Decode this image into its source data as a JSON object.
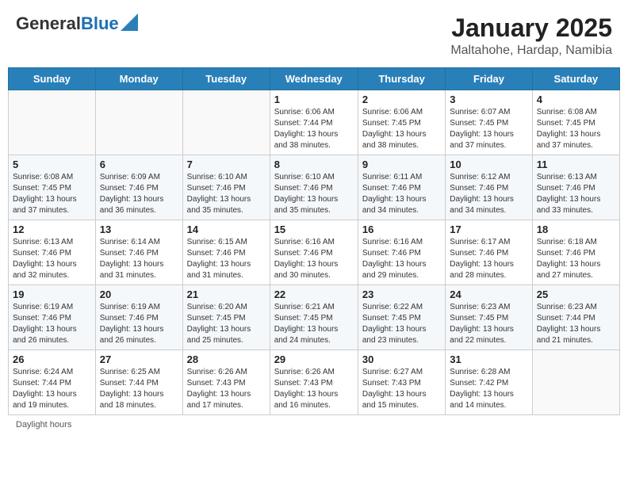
{
  "header": {
    "logo_general": "General",
    "logo_blue": "Blue",
    "month_year": "January 2025",
    "location": "Maltahohe, Hardap, Namibia"
  },
  "days_of_week": [
    "Sunday",
    "Monday",
    "Tuesday",
    "Wednesday",
    "Thursday",
    "Friday",
    "Saturday"
  ],
  "weeks": [
    [
      {
        "day": "",
        "info": ""
      },
      {
        "day": "",
        "info": ""
      },
      {
        "day": "",
        "info": ""
      },
      {
        "day": "1",
        "info": "Sunrise: 6:06 AM\nSunset: 7:44 PM\nDaylight: 13 hours\nand 38 minutes."
      },
      {
        "day": "2",
        "info": "Sunrise: 6:06 AM\nSunset: 7:45 PM\nDaylight: 13 hours\nand 38 minutes."
      },
      {
        "day": "3",
        "info": "Sunrise: 6:07 AM\nSunset: 7:45 PM\nDaylight: 13 hours\nand 37 minutes."
      },
      {
        "day": "4",
        "info": "Sunrise: 6:08 AM\nSunset: 7:45 PM\nDaylight: 13 hours\nand 37 minutes."
      }
    ],
    [
      {
        "day": "5",
        "info": "Sunrise: 6:08 AM\nSunset: 7:45 PM\nDaylight: 13 hours\nand 37 minutes."
      },
      {
        "day": "6",
        "info": "Sunrise: 6:09 AM\nSunset: 7:46 PM\nDaylight: 13 hours\nand 36 minutes."
      },
      {
        "day": "7",
        "info": "Sunrise: 6:10 AM\nSunset: 7:46 PM\nDaylight: 13 hours\nand 35 minutes."
      },
      {
        "day": "8",
        "info": "Sunrise: 6:10 AM\nSunset: 7:46 PM\nDaylight: 13 hours\nand 35 minutes."
      },
      {
        "day": "9",
        "info": "Sunrise: 6:11 AM\nSunset: 7:46 PM\nDaylight: 13 hours\nand 34 minutes."
      },
      {
        "day": "10",
        "info": "Sunrise: 6:12 AM\nSunset: 7:46 PM\nDaylight: 13 hours\nand 34 minutes."
      },
      {
        "day": "11",
        "info": "Sunrise: 6:13 AM\nSunset: 7:46 PM\nDaylight: 13 hours\nand 33 minutes."
      }
    ],
    [
      {
        "day": "12",
        "info": "Sunrise: 6:13 AM\nSunset: 7:46 PM\nDaylight: 13 hours\nand 32 minutes."
      },
      {
        "day": "13",
        "info": "Sunrise: 6:14 AM\nSunset: 7:46 PM\nDaylight: 13 hours\nand 31 minutes."
      },
      {
        "day": "14",
        "info": "Sunrise: 6:15 AM\nSunset: 7:46 PM\nDaylight: 13 hours\nand 31 minutes."
      },
      {
        "day": "15",
        "info": "Sunrise: 6:16 AM\nSunset: 7:46 PM\nDaylight: 13 hours\nand 30 minutes."
      },
      {
        "day": "16",
        "info": "Sunrise: 6:16 AM\nSunset: 7:46 PM\nDaylight: 13 hours\nand 29 minutes."
      },
      {
        "day": "17",
        "info": "Sunrise: 6:17 AM\nSunset: 7:46 PM\nDaylight: 13 hours\nand 28 minutes."
      },
      {
        "day": "18",
        "info": "Sunrise: 6:18 AM\nSunset: 7:46 PM\nDaylight: 13 hours\nand 27 minutes."
      }
    ],
    [
      {
        "day": "19",
        "info": "Sunrise: 6:19 AM\nSunset: 7:46 PM\nDaylight: 13 hours\nand 26 minutes."
      },
      {
        "day": "20",
        "info": "Sunrise: 6:19 AM\nSunset: 7:46 PM\nDaylight: 13 hours\nand 26 minutes."
      },
      {
        "day": "21",
        "info": "Sunrise: 6:20 AM\nSunset: 7:45 PM\nDaylight: 13 hours\nand 25 minutes."
      },
      {
        "day": "22",
        "info": "Sunrise: 6:21 AM\nSunset: 7:45 PM\nDaylight: 13 hours\nand 24 minutes."
      },
      {
        "day": "23",
        "info": "Sunrise: 6:22 AM\nSunset: 7:45 PM\nDaylight: 13 hours\nand 23 minutes."
      },
      {
        "day": "24",
        "info": "Sunrise: 6:23 AM\nSunset: 7:45 PM\nDaylight: 13 hours\nand 22 minutes."
      },
      {
        "day": "25",
        "info": "Sunrise: 6:23 AM\nSunset: 7:44 PM\nDaylight: 13 hours\nand 21 minutes."
      }
    ],
    [
      {
        "day": "26",
        "info": "Sunrise: 6:24 AM\nSunset: 7:44 PM\nDaylight: 13 hours\nand 19 minutes."
      },
      {
        "day": "27",
        "info": "Sunrise: 6:25 AM\nSunset: 7:44 PM\nDaylight: 13 hours\nand 18 minutes."
      },
      {
        "day": "28",
        "info": "Sunrise: 6:26 AM\nSunset: 7:43 PM\nDaylight: 13 hours\nand 17 minutes."
      },
      {
        "day": "29",
        "info": "Sunrise: 6:26 AM\nSunset: 7:43 PM\nDaylight: 13 hours\nand 16 minutes."
      },
      {
        "day": "30",
        "info": "Sunrise: 6:27 AM\nSunset: 7:43 PM\nDaylight: 13 hours\nand 15 minutes."
      },
      {
        "day": "31",
        "info": "Sunrise: 6:28 AM\nSunset: 7:42 PM\nDaylight: 13 hours\nand 14 minutes."
      },
      {
        "day": "",
        "info": ""
      }
    ]
  ],
  "footer": {
    "daylight_label": "Daylight hours"
  }
}
